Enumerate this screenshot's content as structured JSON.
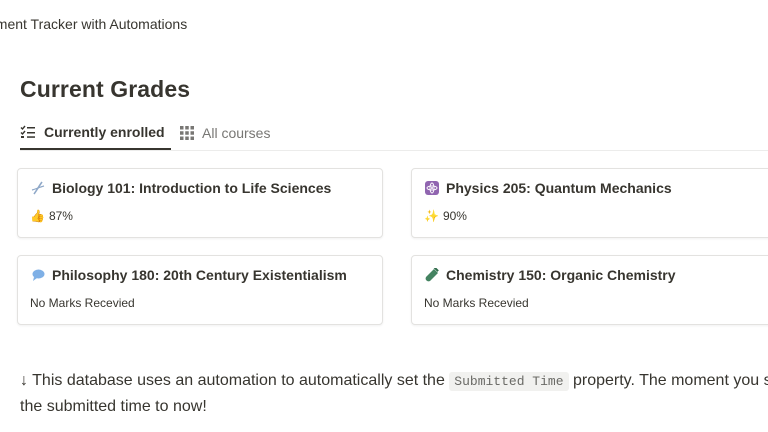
{
  "page": {
    "breadcrumb": "nment Tracker with Automations",
    "title": "Current Grades"
  },
  "tabs": [
    {
      "label": "Currently enrolled",
      "icon": "checklist-icon",
      "active": true
    },
    {
      "label": "All courses",
      "icon": "grid-icon",
      "active": false
    }
  ],
  "cards": [
    {
      "title": "Biology 101: Introduction to Life Sciences",
      "icon": "dna-icon",
      "grade_icon": "thumbs-up-icon",
      "grade_glyph": "👍",
      "grade": "87%"
    },
    {
      "title": "Physics 205: Quantum Mechanics",
      "icon": "atom-icon",
      "grade_icon": "sparkles-icon",
      "grade_glyph": "✨",
      "grade": "90%"
    },
    {
      "title": "Philosophy 180: 20th Century Existentialism",
      "icon": "speech-bubble-icon",
      "grade": "No Marks Recevied"
    },
    {
      "title": "Chemistry 150: Organic Chemistry",
      "icon": "test-tube-icon",
      "grade": "No Marks Recevied"
    }
  ],
  "note": {
    "prefix": "↓ This database uses an automation to automatically set the",
    "code": "Submitted Time",
    "suffix": "property. The moment you s",
    "line2": "the submitted time to now!"
  },
  "colors": {
    "text": "#37352f",
    "muted": "#787774",
    "border": "#e3e2e0",
    "physics_icon_bg": "#9065b0",
    "chemistry_icon": "#448361",
    "philosophy_icon": "#7fb0e6"
  }
}
